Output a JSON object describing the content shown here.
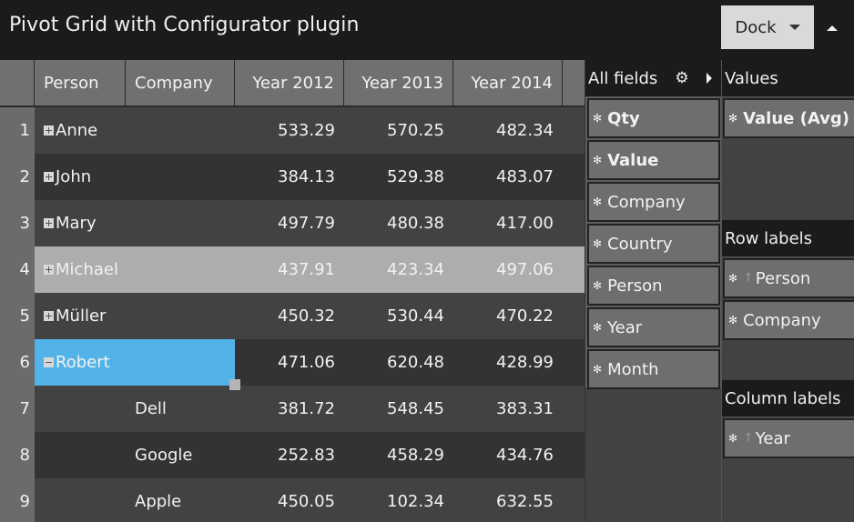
{
  "window": {
    "title": "Pivot Grid with Configurator plugin",
    "dock_label": "Dock",
    "collapse_icon": "triangle-up-icon"
  },
  "grid": {
    "columns": [
      "Person",
      "Company",
      "Year 2012",
      "Year 2013",
      "Year 2014"
    ],
    "rows": [
      {
        "num": "1",
        "person": "Anne",
        "company": "",
        "toggle": "plus",
        "v2012": "533.29",
        "v2013": "570.25",
        "v2014": "482.34",
        "state": "odd"
      },
      {
        "num": "2",
        "person": "John",
        "company": "",
        "toggle": "plus",
        "v2012": "384.13",
        "v2013": "529.38",
        "v2014": "483.07",
        "state": "even"
      },
      {
        "num": "3",
        "person": "Mary",
        "company": "",
        "toggle": "plus",
        "v2012": "497.79",
        "v2013": "480.38",
        "v2014": "417.00",
        "state": "odd"
      },
      {
        "num": "4",
        "person": "Michael",
        "company": "",
        "toggle": "plus",
        "v2012": "437.91",
        "v2013": "423.34",
        "v2014": "497.06",
        "state": "sel"
      },
      {
        "num": "5",
        "person": "Müller",
        "company": "",
        "toggle": "plus",
        "v2012": "450.32",
        "v2013": "530.44",
        "v2014": "470.22",
        "state": "odd"
      },
      {
        "num": "6",
        "person": "Robert",
        "company": "",
        "toggle": "minus",
        "v2012": "471.06",
        "v2013": "620.48",
        "v2014": "428.99",
        "state": "even",
        "active": true
      },
      {
        "num": "7",
        "person": "",
        "company": "Dell",
        "toggle": "",
        "v2012": "381.72",
        "v2013": "548.45",
        "v2014": "383.31",
        "state": "odd"
      },
      {
        "num": "8",
        "person": "",
        "company": "Google",
        "toggle": "",
        "v2012": "252.83",
        "v2013": "458.29",
        "v2014": "434.76",
        "state": "even"
      },
      {
        "num": "9",
        "person": "",
        "company": "Apple",
        "toggle": "",
        "v2012": "450.05",
        "v2013": "102.34",
        "v2014": "632.55",
        "state": "odd"
      }
    ],
    "colors": {
      "active_cell": "#53b3e8",
      "selected_row": "#adadad",
      "header": "#707070"
    }
  },
  "configurator": {
    "all_fields": {
      "title": "All fields",
      "settings_icon": "gear-icon",
      "expand_icon": "triangle-right-icon",
      "fields": [
        {
          "label": "Qty",
          "bold": true
        },
        {
          "label": "Value",
          "bold": true
        },
        {
          "label": "Company",
          "bold": false
        },
        {
          "label": "Country",
          "bold": false
        },
        {
          "label": "Person",
          "bold": false
        },
        {
          "label": "Year",
          "bold": false
        },
        {
          "label": "Month",
          "bold": false
        }
      ]
    },
    "values": {
      "title": "Values",
      "fields": [
        {
          "label": "Value (Avg)",
          "bold": true
        }
      ]
    },
    "row_labels": {
      "title": "Row labels",
      "fields": [
        {
          "label": "Person",
          "sort": "asc"
        },
        {
          "label": "Company",
          "sort": ""
        }
      ]
    },
    "column_labels": {
      "title": "Column labels",
      "fields": [
        {
          "label": "Year",
          "sort": "asc"
        }
      ]
    }
  }
}
